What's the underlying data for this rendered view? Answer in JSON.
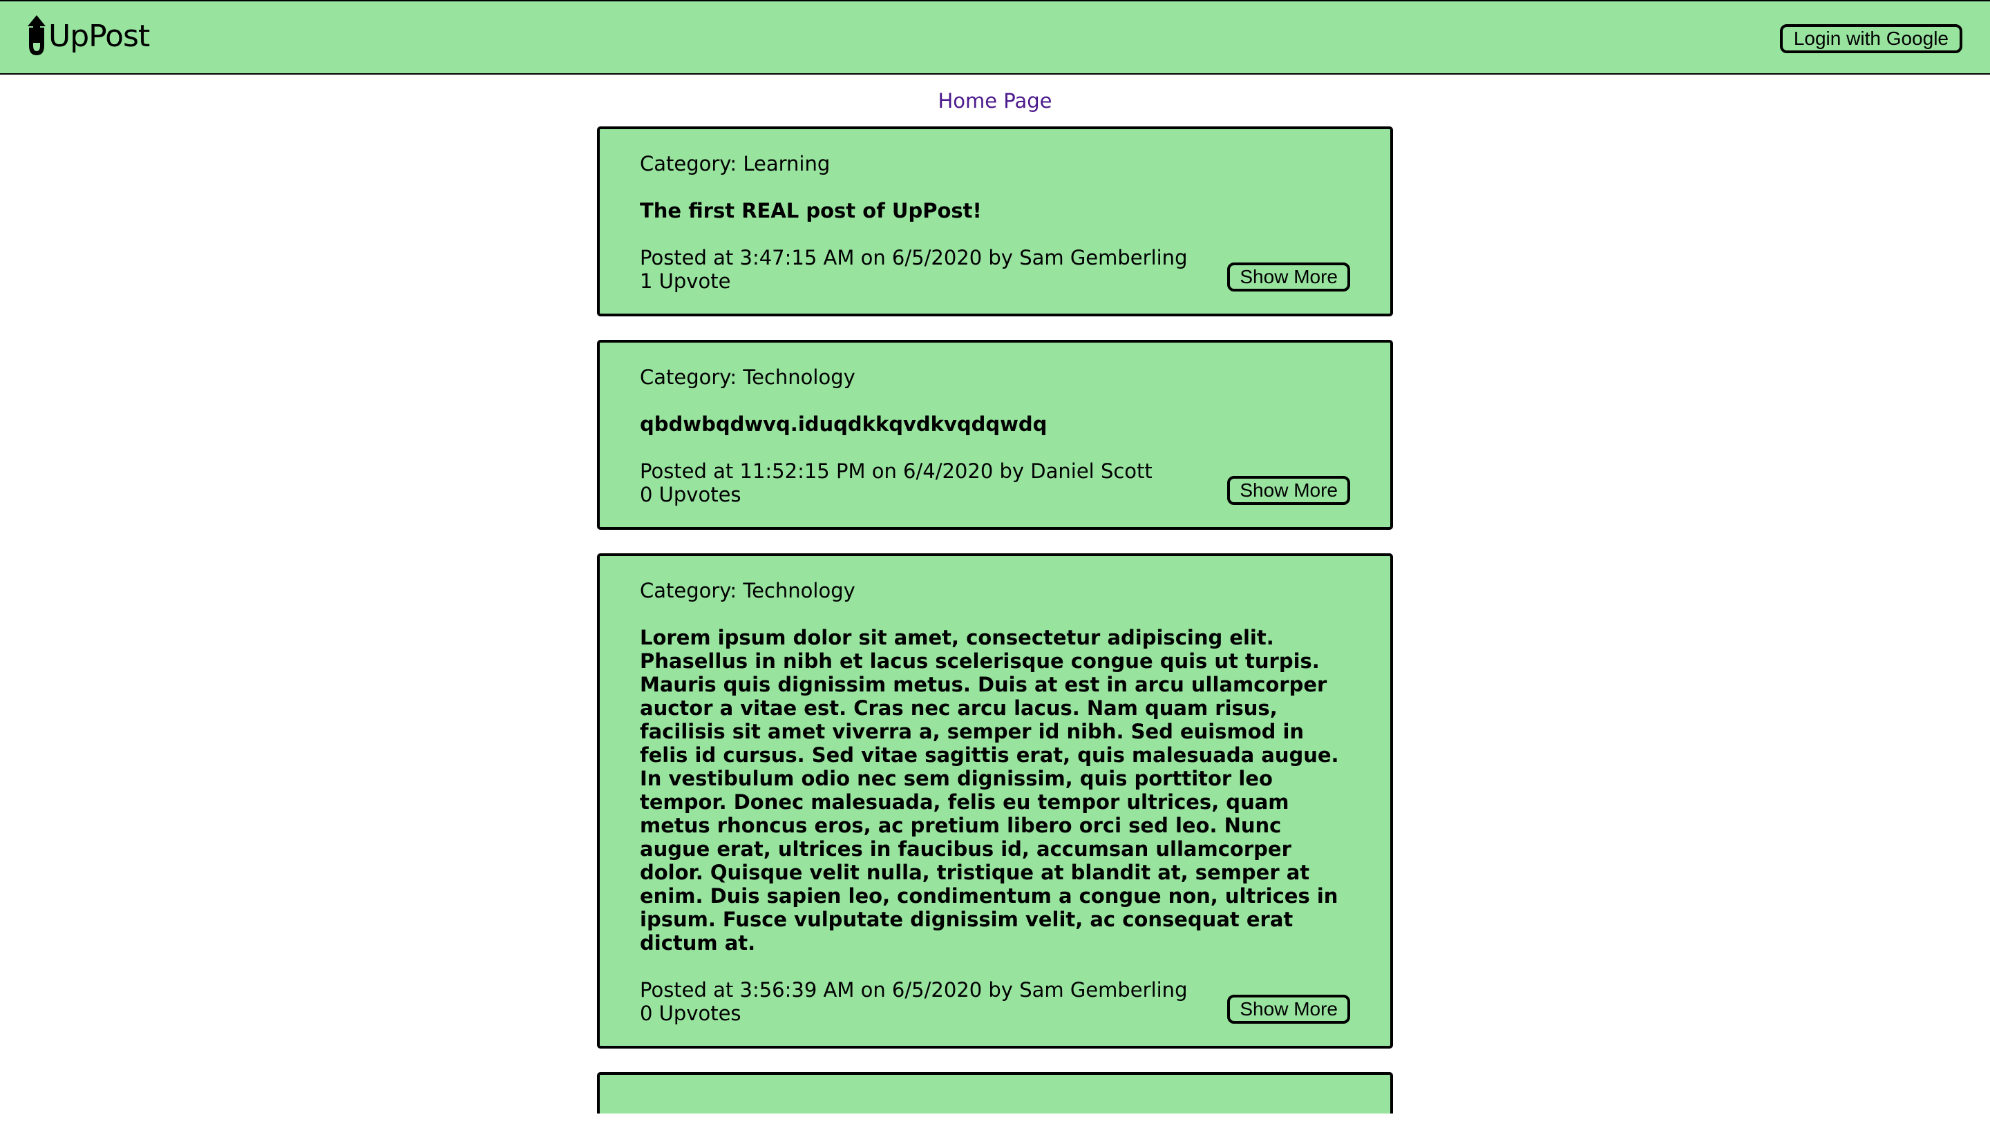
{
  "header": {
    "logo_text": "UpPost",
    "logo_icon": "up-arrow-icon",
    "login_label": "Login with Google"
  },
  "nav": {
    "home_label": "Home Page"
  },
  "posts": [
    {
      "category": "Category: Learning",
      "title": "The first REAL post of UpPost!",
      "meta": "Posted at 3:47:15 AM on 6/5/2020 by Sam Gemberling",
      "votes": "1 Upvote",
      "button": "Show More"
    },
    {
      "category": "Category: Technology",
      "title": "qbdwbqdwvq.iduqdkkqvdkvqdqwdq",
      "meta": "Posted at 11:52:15 PM on 6/4/2020 by Daniel Scott",
      "votes": "0 Upvotes",
      "button": "Show More"
    },
    {
      "category": "Category: Technology",
      "title": "Lorem ipsum dolor sit amet, consectetur adipiscing elit. Phasellus in nibh et lacus scelerisque congue quis ut turpis. Mauris quis dignissim metus. Duis at est in arcu ullamcorper auctor a vitae est. Cras nec arcu lacus. Nam quam risus, facilisis sit amet viverra a, semper id nibh. Sed euismod in felis id cursus. Sed vitae sagittis erat, quis malesuada augue. In vestibulum odio nec sem dignissim, quis porttitor leo tempor. Donec malesuada, felis eu tempor ultrices, quam metus rhoncus eros, ac pretium libero orci sed leo. Nunc augue erat, ultrices in faucibus id, accumsan ullamcorper dolor. Quisque velit nulla, tristique at blandit at, semper at enim. Duis sapien leo, condimentum a congue non, ultrices in ipsum. Fusce vulputate dignissim velit, ac consequat erat dictum at.",
      "meta": "Posted at 3:56:39 AM on 6/5/2020 by Sam Gemberling",
      "votes": "0 Upvotes",
      "button": "Show More"
    }
  ],
  "colors": {
    "accent": "#98e49f",
    "link": "#4b1a8c"
  }
}
